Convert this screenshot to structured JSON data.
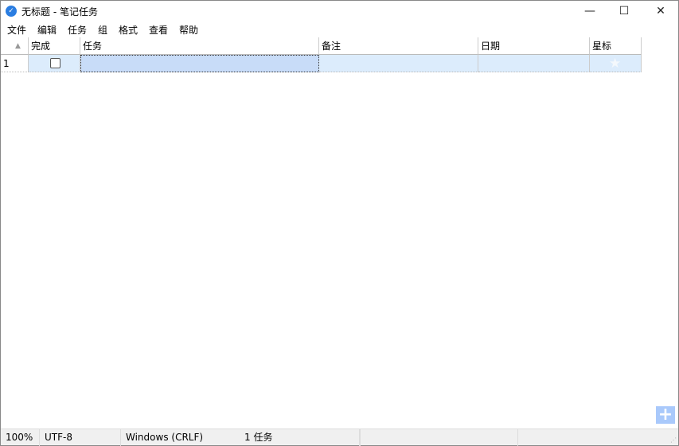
{
  "window": {
    "title": "无标题 - 笔记任务",
    "minimize": "—",
    "maximize": "☐",
    "close": "✕"
  },
  "menu": [
    "文件",
    "编辑",
    "任务",
    "组",
    "格式",
    "查看",
    "帮助"
  ],
  "table": {
    "headers": {
      "done": "完成",
      "task": "任务",
      "note": "备注",
      "date": "日期",
      "star": "星标"
    },
    "rows": [
      {
        "num": "1",
        "done": false,
        "task": "",
        "note": "",
        "date": "",
        "starred": false
      }
    ]
  },
  "add_button": "+",
  "status": {
    "zoom": "100%",
    "encoding": "UTF-8",
    "line_ending": "Windows (CRLF)",
    "count": "1 任务"
  }
}
